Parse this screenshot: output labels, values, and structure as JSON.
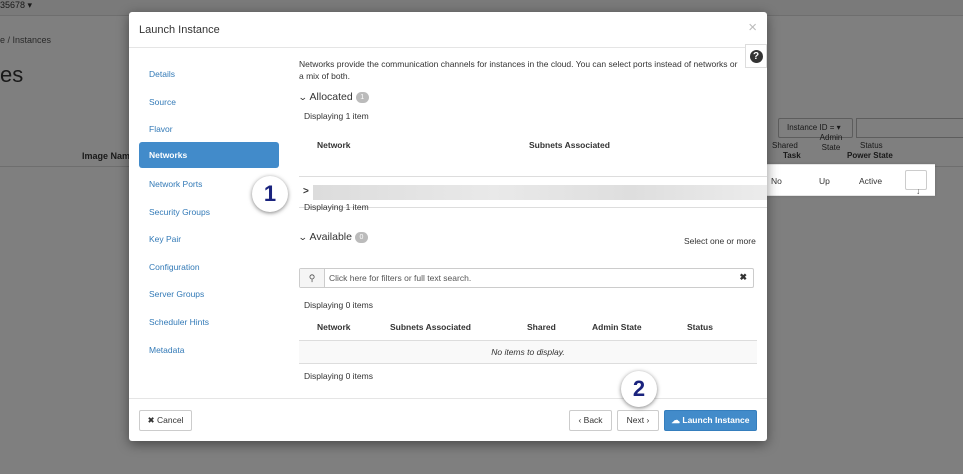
{
  "background": {
    "project": "35678 ▾",
    "breadcrumb": "e / Instances",
    "page_title": "es",
    "image_name_col": "Image Nam",
    "filter_button": "Instance ID = ▾",
    "columns": [
      "Shared",
      "Task",
      "Admin State",
      "Status",
      "Power State"
    ],
    "row": {
      "shared": "No",
      "admin_state": "Up",
      "status": "Active",
      "action_icon": "arrow-down-icon"
    }
  },
  "modal": {
    "title": "Launch Instance",
    "close_glyph": "×",
    "help_glyph": "?",
    "nav": [
      {
        "label": "Details"
      },
      {
        "label": "Source"
      },
      {
        "label": "Flavor"
      },
      {
        "label": "Networks",
        "active": true
      },
      {
        "label": "Network Ports"
      },
      {
        "label": "Security Groups"
      },
      {
        "label": "Key Pair"
      },
      {
        "label": "Configuration"
      },
      {
        "label": "Server Groups"
      },
      {
        "label": "Scheduler Hints"
      },
      {
        "label": "Metadata"
      }
    ],
    "description": "Networks provide the communication channels for instances in the cloud. You can select ports instead of networks or a mix of both.",
    "allocated": {
      "heading": "Allocated",
      "count": "1",
      "displaying_top": "Displaying 1 item",
      "headers": [
        "Network",
        "Subnets Associated"
      ],
      "expander": ">",
      "displaying_bottom": "Displaying 1 item"
    },
    "available": {
      "heading": "Available",
      "count": "0",
      "select_hint": "Select one or more",
      "search_placeholder": "Click here for filters or full text search.",
      "clear_glyph": "✖",
      "displaying_top": "Displaying 0 items",
      "headers": [
        "Network",
        "Subnets Associated",
        "Shared",
        "Admin State",
        "Status"
      ],
      "empty_text": "No items to display.",
      "displaying_bottom": "Displaying 0 items"
    },
    "footer": {
      "cancel": "✖ Cancel",
      "back": "‹ Back",
      "next": "Next ›",
      "launch": "☁ Launch Instance"
    }
  },
  "markers": [
    "1",
    "2"
  ],
  "colors": {
    "primary": "#428bca",
    "link": "#337ab7",
    "marker_text": "#1a237e"
  }
}
